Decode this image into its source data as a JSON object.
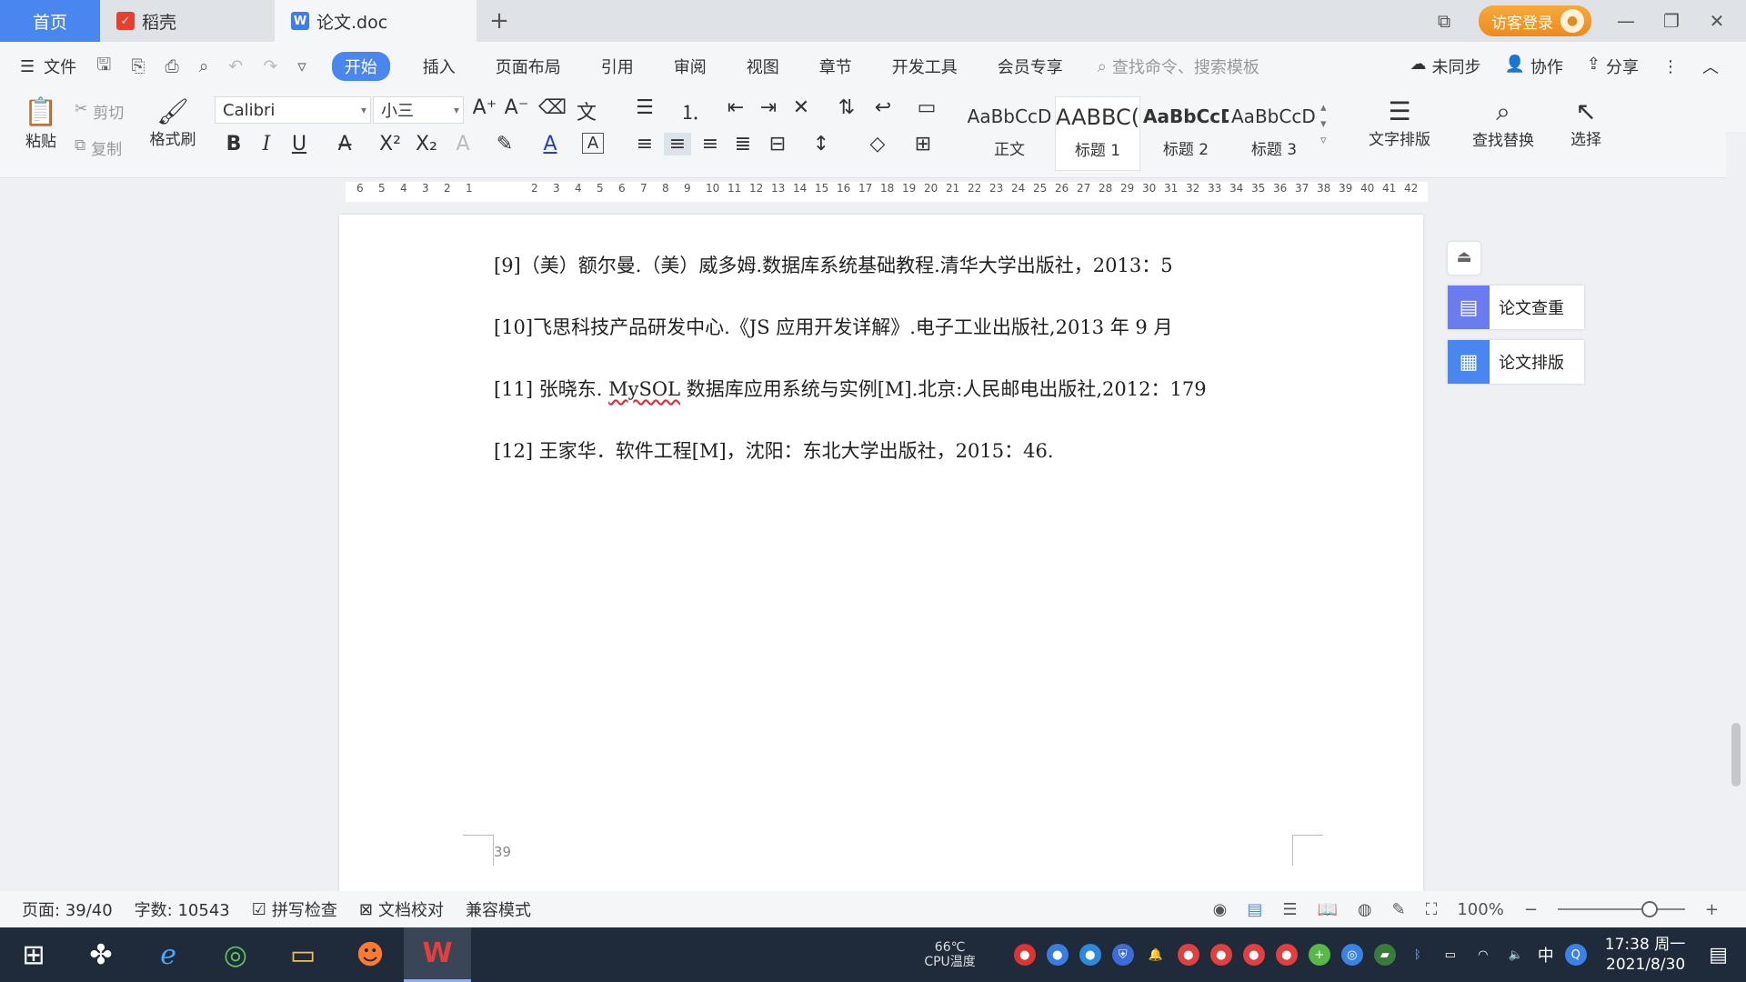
{
  "tabs": {
    "home": "首页",
    "daoke": "稻壳",
    "doc": "论文.doc",
    "add": "+"
  },
  "titlebar": {
    "login": "访客登录"
  },
  "menu": {
    "file": "文件",
    "items": [
      "开始",
      "插入",
      "页面布局",
      "引用",
      "审阅",
      "视图",
      "章节",
      "开发工具",
      "会员专享"
    ],
    "search_placeholder": "查找命令、搜索模板",
    "sync": "未同步",
    "collab": "协作",
    "share": "分享"
  },
  "ribbon": {
    "paste": "粘贴",
    "cut": "剪切",
    "copy": "复制",
    "format_painter": "格式刷",
    "font_name": "Calibri",
    "font_size": "小三",
    "styles": [
      {
        "sample": "AaBbCcD",
        "name": "正文"
      },
      {
        "sample": "AABBC(",
        "name": "标题 1"
      },
      {
        "sample": "AaBbCcD",
        "name": "标题 2"
      },
      {
        "sample": "AaBbCcDc",
        "name": "标题 3"
      }
    ],
    "text_layout": "文字排版",
    "find_replace": "查找替换",
    "select": "选择"
  },
  "ruler": {
    "left_numbers": [
      "6",
      "5",
      "4",
      "3",
      "2",
      "1"
    ],
    "right_numbers": [
      "2",
      "3",
      "4",
      "5",
      "6",
      "7",
      "8",
      "9",
      "10",
      "11",
      "12",
      "13",
      "14",
      "15",
      "16",
      "17",
      "18",
      "19",
      "20",
      "21",
      "22",
      "23",
      "24",
      "25",
      "26",
      "27",
      "28",
      "29",
      "30",
      "31",
      "32",
      "33",
      "34",
      "35",
      "36",
      "37",
      "38",
      "39",
      "40",
      "41",
      "42"
    ]
  },
  "document": {
    "refs": [
      "[9]（美）额尔曼.（美）威多姆.数据库系统基础教程.清华大学出版社，2013：5",
      "[10]飞思科技产品研发中心.《JS 应用开发详解》.电子工业出版社,2013 年 9 月",
      {
        "pre": "[11]  张晓东. ",
        "misspelled": "MySOL",
        "post": " 数据库应用系统与实例[M].北京:人民邮电出版社,2012：179"
      },
      "[12]  王家华．软件工程[M]，沈阳：东北大学出版社，2015：46."
    ],
    "page_number": "39"
  },
  "side_panel": {
    "check": "论文查重",
    "layout": "论文排版"
  },
  "status": {
    "page": "页面: 39/40",
    "words": "字数: 10543",
    "spell": "拼写检查",
    "proof": "文档校对",
    "compat": "兼容模式",
    "zoom": "100%",
    "zoom_level_percent": 100
  },
  "taskbar": {
    "cpu_temp": "66℃",
    "cpu_label": "CPU温度",
    "ime": "中",
    "time": "17:38 周一",
    "date": "2021/8/30"
  },
  "colors": {
    "accent": "#4a86f0",
    "login": "#f0961f",
    "wps_red": "#d9322b"
  }
}
